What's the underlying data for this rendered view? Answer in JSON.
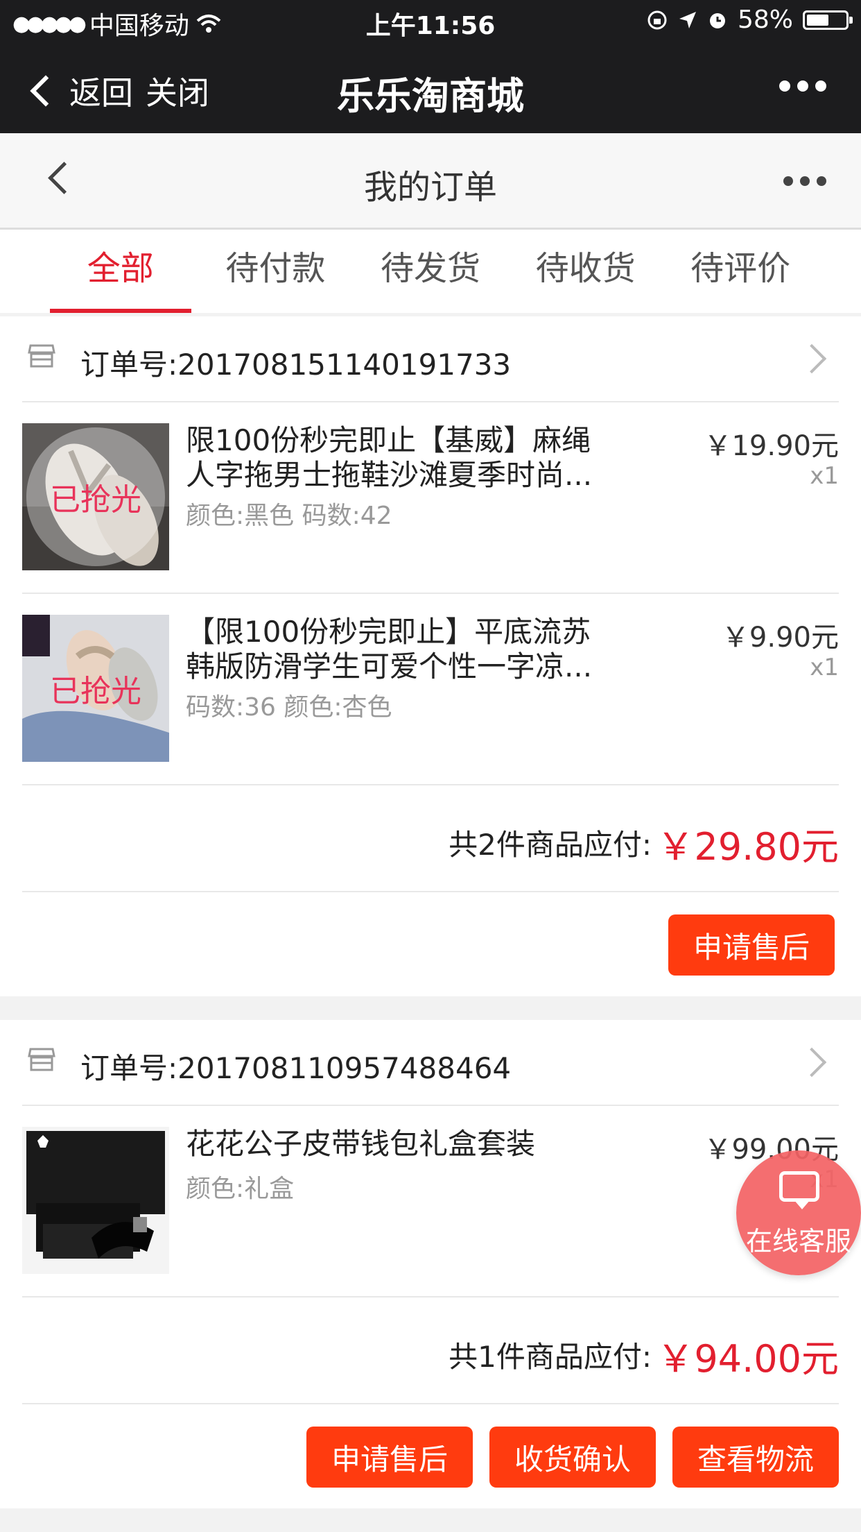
{
  "status_bar": {
    "carrier": "中国移动",
    "time": "上午11:56",
    "battery": "58%",
    "battery_level": 0.58
  },
  "wechat_header": {
    "back_label": "返回",
    "close_label": "关闭",
    "title": "乐乐淘商城"
  },
  "nav": {
    "title": "我的订单"
  },
  "tabs": [
    {
      "label": "全部",
      "active": true
    },
    {
      "label": "待付款",
      "active": false
    },
    {
      "label": "待发货",
      "active": false
    },
    {
      "label": "待收货",
      "active": false
    },
    {
      "label": "待评价",
      "active": false
    }
  ],
  "orders": [
    {
      "order_no": "订单号:20170815114019173 3",
      "items": [
        {
          "name": "限100份秒完即止【基威】麻绳人字拖男士拖鞋沙滩夏季时尚...",
          "spec": "颜色:黑色 码数:42",
          "price": "￥19.90元",
          "qty": "x1",
          "sold_out": "已抢光"
        },
        {
          "name": "【限100份秒完即止】平底流苏韩版防滑学生可爱个性一字凉...",
          "spec": "码数:36 颜色:杏色",
          "price": "￥9.90元",
          "qty": "x1",
          "sold_out": "已抢光"
        }
      ],
      "total_label": "共2件商品应付:",
      "total_amount": "￥29.80元",
      "buttons": [
        "申请售后"
      ]
    },
    {
      "order_no": "订单号:201708110957488464",
      "items": [
        {
          "name": "花花公子皮带钱包礼盒套装",
          "spec": "颜色:礼盒",
          "price": "￥99.00元",
          "qty": "x1"
        }
      ],
      "total_label": "共1件商品应付:",
      "total_amount": "￥94.00元",
      "buttons": [
        "申请售后",
        "收货确认",
        "查看物流"
      ]
    }
  ],
  "customer_service": {
    "label": "在线客服"
  },
  "colors": {
    "accent": "#e21f2f",
    "button": "#ff3b0f",
    "header_bg": "#1c1c1e"
  }
}
